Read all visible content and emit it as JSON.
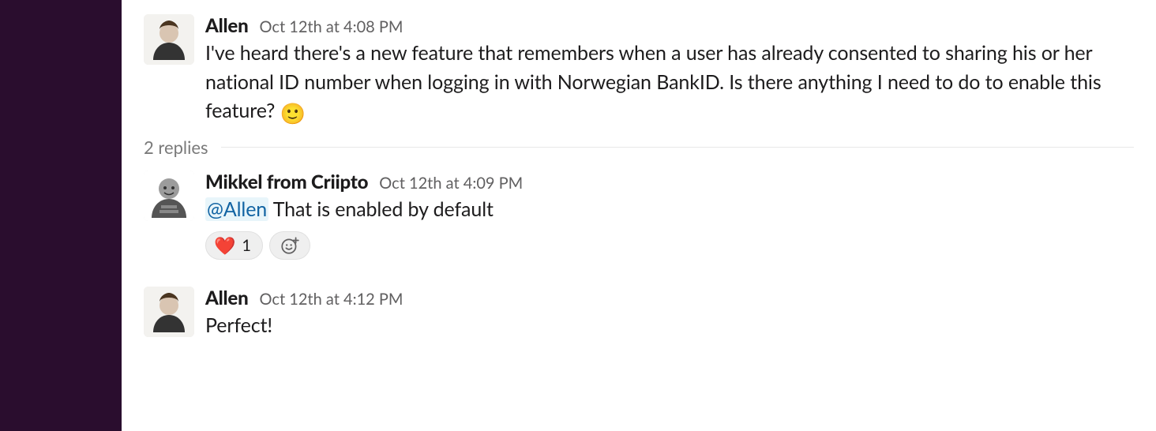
{
  "messages": [
    {
      "author": "Allen",
      "timestamp": "Oct 12th at 4:08 PM",
      "body": "I've heard there's a new feature that remembers when a user has already consented to sharing his or her national ID number when logging in with Norwegian BankID.  Is there anything I need to do to enable this feature?  ",
      "trailing_emoji": "🙂"
    }
  ],
  "replies_label": "2 replies",
  "replies": [
    {
      "author": "Mikkel from Criipto",
      "timestamp": "Oct 12th at 4:09 PM",
      "mention": "@Allen",
      "body": " That is enabled by default",
      "reactions": [
        {
          "emoji": "❤️",
          "count": "1"
        }
      ]
    },
    {
      "author": "Allen",
      "timestamp": "Oct 12th at 4:12 PM",
      "body": "Perfect!"
    }
  ]
}
